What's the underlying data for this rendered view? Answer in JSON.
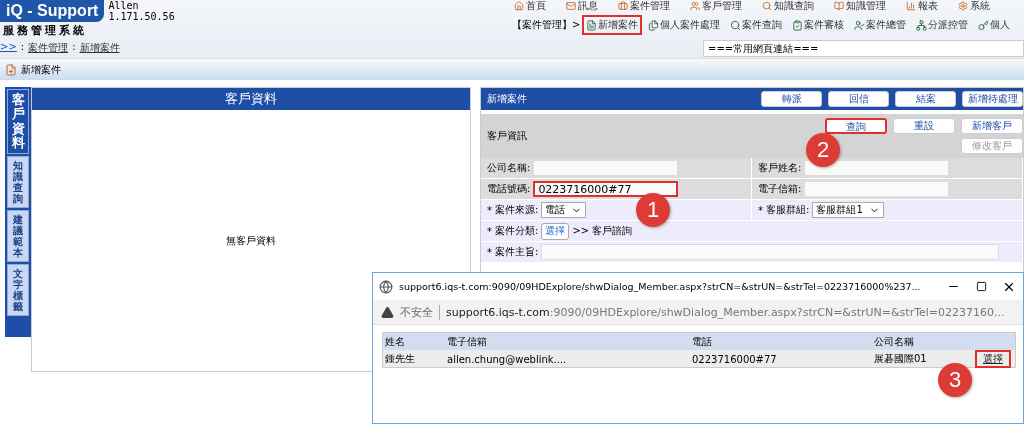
{
  "header": {
    "logo": "iQ - Support",
    "user": "Allen",
    "version": "1.171.50.56",
    "system_name": "服務管理系統",
    "breadcrumb_start": ">>",
    "separator": ":",
    "breadcrumb": [
      "案件管理",
      "新增案件"
    ]
  },
  "top_nav": [
    "首頁",
    "訊息",
    "案件管理",
    "客戶管理",
    "知識查詢",
    "知識管理",
    "報表",
    "系統"
  ],
  "sub_nav": {
    "section": "【案件管理】>",
    "items": [
      {
        "label": "新增案件",
        "highlighted": true
      },
      {
        "label": "個人案件處理",
        "highlighted": false
      },
      {
        "label": "案件查詢",
        "highlighted": false
      },
      {
        "label": "案件審核",
        "highlighted": false
      },
      {
        "label": "案件總管",
        "highlighted": false
      },
      {
        "label": "分派控管",
        "highlighted": false
      },
      {
        "label": "個人",
        "highlighted": false
      }
    ]
  },
  "links_select": "===常用網頁連結===",
  "toolbar": {
    "title": "新增案件"
  },
  "side_tabs": [
    {
      "label": "客戶資料",
      "selected": true
    },
    {
      "label": "知識查詢",
      "selected": false
    },
    {
      "label": "建議範本",
      "selected": false
    },
    {
      "label": "文字標籤",
      "selected": false
    }
  ],
  "customer_panel": {
    "title": "客戶資料",
    "empty_text": "無客戶資料"
  },
  "case_panel": {
    "title": "新增案件",
    "buttons": [
      "轉派",
      "回信",
      "結案",
      "新增待處理"
    ],
    "section_title": "客戶資訊",
    "section_buttons": [
      {
        "label": "查詢",
        "highlighted": true,
        "disabled": false
      },
      {
        "label": "重設",
        "highlighted": false,
        "disabled": false
      },
      {
        "label": "新增客戶",
        "highlighted": false,
        "disabled": false
      },
      {
        "label": "修改客戶",
        "highlighted": false,
        "disabled": true
      }
    ],
    "fields": [
      {
        "kind": "text",
        "label": "公司名稱:",
        "highlighted": false
      },
      {
        "kind": "text",
        "label": "客戶姓名:",
        "highlighted": false
      },
      {
        "kind": "text",
        "label": "電話號碼:",
        "value": "0223716000#77",
        "highlighted": true
      },
      {
        "kind": "text",
        "label": "電子信箱:",
        "highlighted": false
      },
      {
        "kind": "select",
        "marker": "*",
        "label": "案件來源:",
        "value": "電話"
      },
      {
        "kind": "select",
        "marker": "*",
        "label": "客服群組:",
        "value": "客服群組1"
      },
      {
        "kind": "choose",
        "marker": "*",
        "label": "案件分類:",
        "button": "選擇",
        "value": ">> 客戶諮詢"
      },
      {
        "kind": "wide",
        "marker": "*",
        "label": "案件主旨:"
      }
    ]
  },
  "popup": {
    "title": "support6.iqs-t.com:9090/09HDExplore/shwDialog_Member.aspx?strCN=&strUN=&strTel=0223716000%237...",
    "security": "不安全",
    "address_host": "support6.iqs-t.com",
    "address_path": ":9090/09HDExplore/shwDialog_Member.aspx?strCN=&strUN=&strTel=02237160...",
    "columns": [
      "姓名",
      "電子信箱",
      "電話",
      "公司名稱"
    ],
    "rows": [
      {
        "cells": [
          "鍾先生",
          "allen.chung@weblink....",
          "0223716000#77",
          "展碁國際01"
        ],
        "action": "選擇",
        "highlighted": true
      }
    ]
  },
  "annotations": [
    "1",
    "2",
    "3"
  ]
}
